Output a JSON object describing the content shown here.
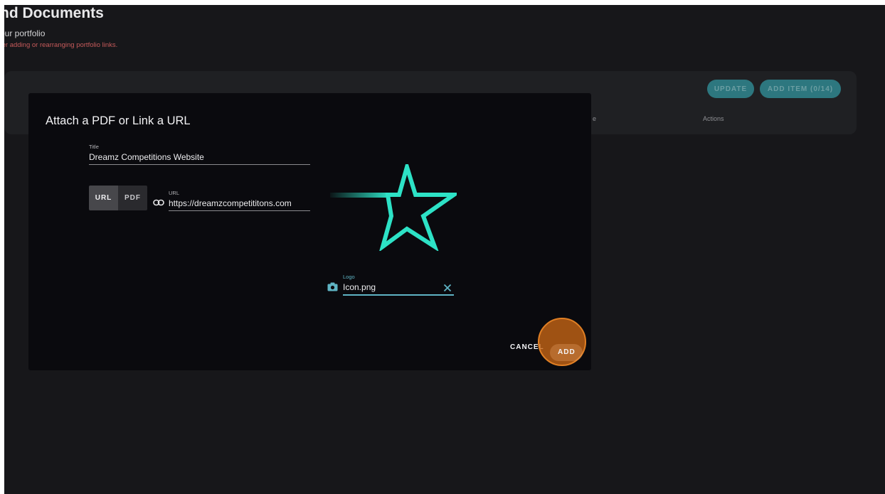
{
  "page": {
    "title": "nd Documents",
    "subtitle": "our portfolio",
    "warning": "ter adding or rearranging portfolio links."
  },
  "table_card": {
    "update_label": "UPDATE",
    "add_item_label": "ADD ITEM (0/14)",
    "col_partial": "e",
    "col_actions": "Actions"
  },
  "dialog": {
    "title": "Attach a PDF or Link a URL",
    "title_field": {
      "label": "Title",
      "value": "Dreamz Competitions Website"
    },
    "type_toggle": {
      "url_label": "URL",
      "pdf_label": "PDF",
      "selected": "URL"
    },
    "url_field": {
      "label": "URL",
      "value": "https://dreamzcompetititons.com",
      "icon": "link-icon"
    },
    "logo_field": {
      "label": "Logo",
      "value": "Icon.png",
      "icon": "camera-icon",
      "clear_icon": "close-icon"
    },
    "cancel_label": "CANCEL",
    "add_label": "ADD"
  },
  "colors": {
    "accent_teal": "#2f8189",
    "logo_label": "#5fb4c4",
    "star": "#2de2c6",
    "highlight": "#e07f24"
  }
}
